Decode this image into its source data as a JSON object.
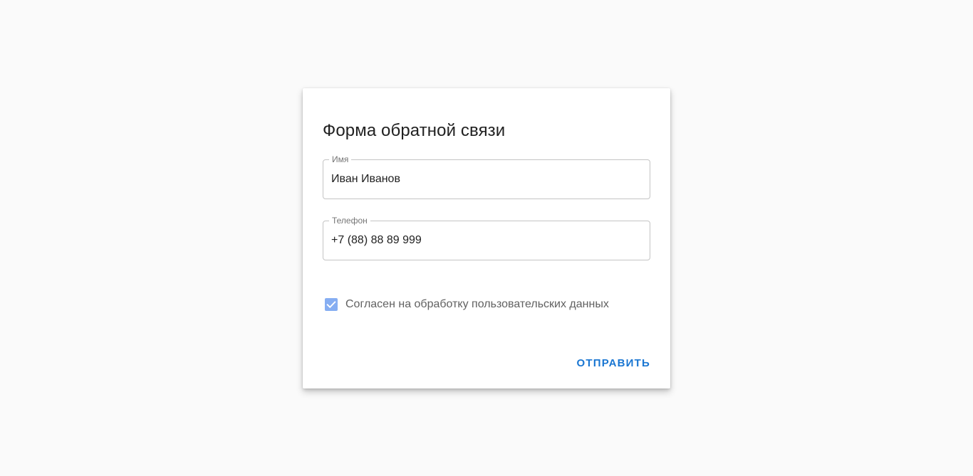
{
  "form": {
    "title": "Форма обратной связи",
    "name_field": {
      "label": "Имя",
      "value": "Иван Иванов"
    },
    "phone_field": {
      "label": "Телефон",
      "value": "+7 (88) 88 89 999"
    },
    "consent": {
      "label": "Согласен на обработку пользовательских данных",
      "checked": true
    },
    "submit_label": "Отправить"
  },
  "colors": {
    "background": "#fafafa",
    "card": "#ffffff",
    "accent": "#1976d2",
    "checkbox": "#86aef2"
  },
  "icons": {
    "consent_checkbox": "check-icon"
  }
}
